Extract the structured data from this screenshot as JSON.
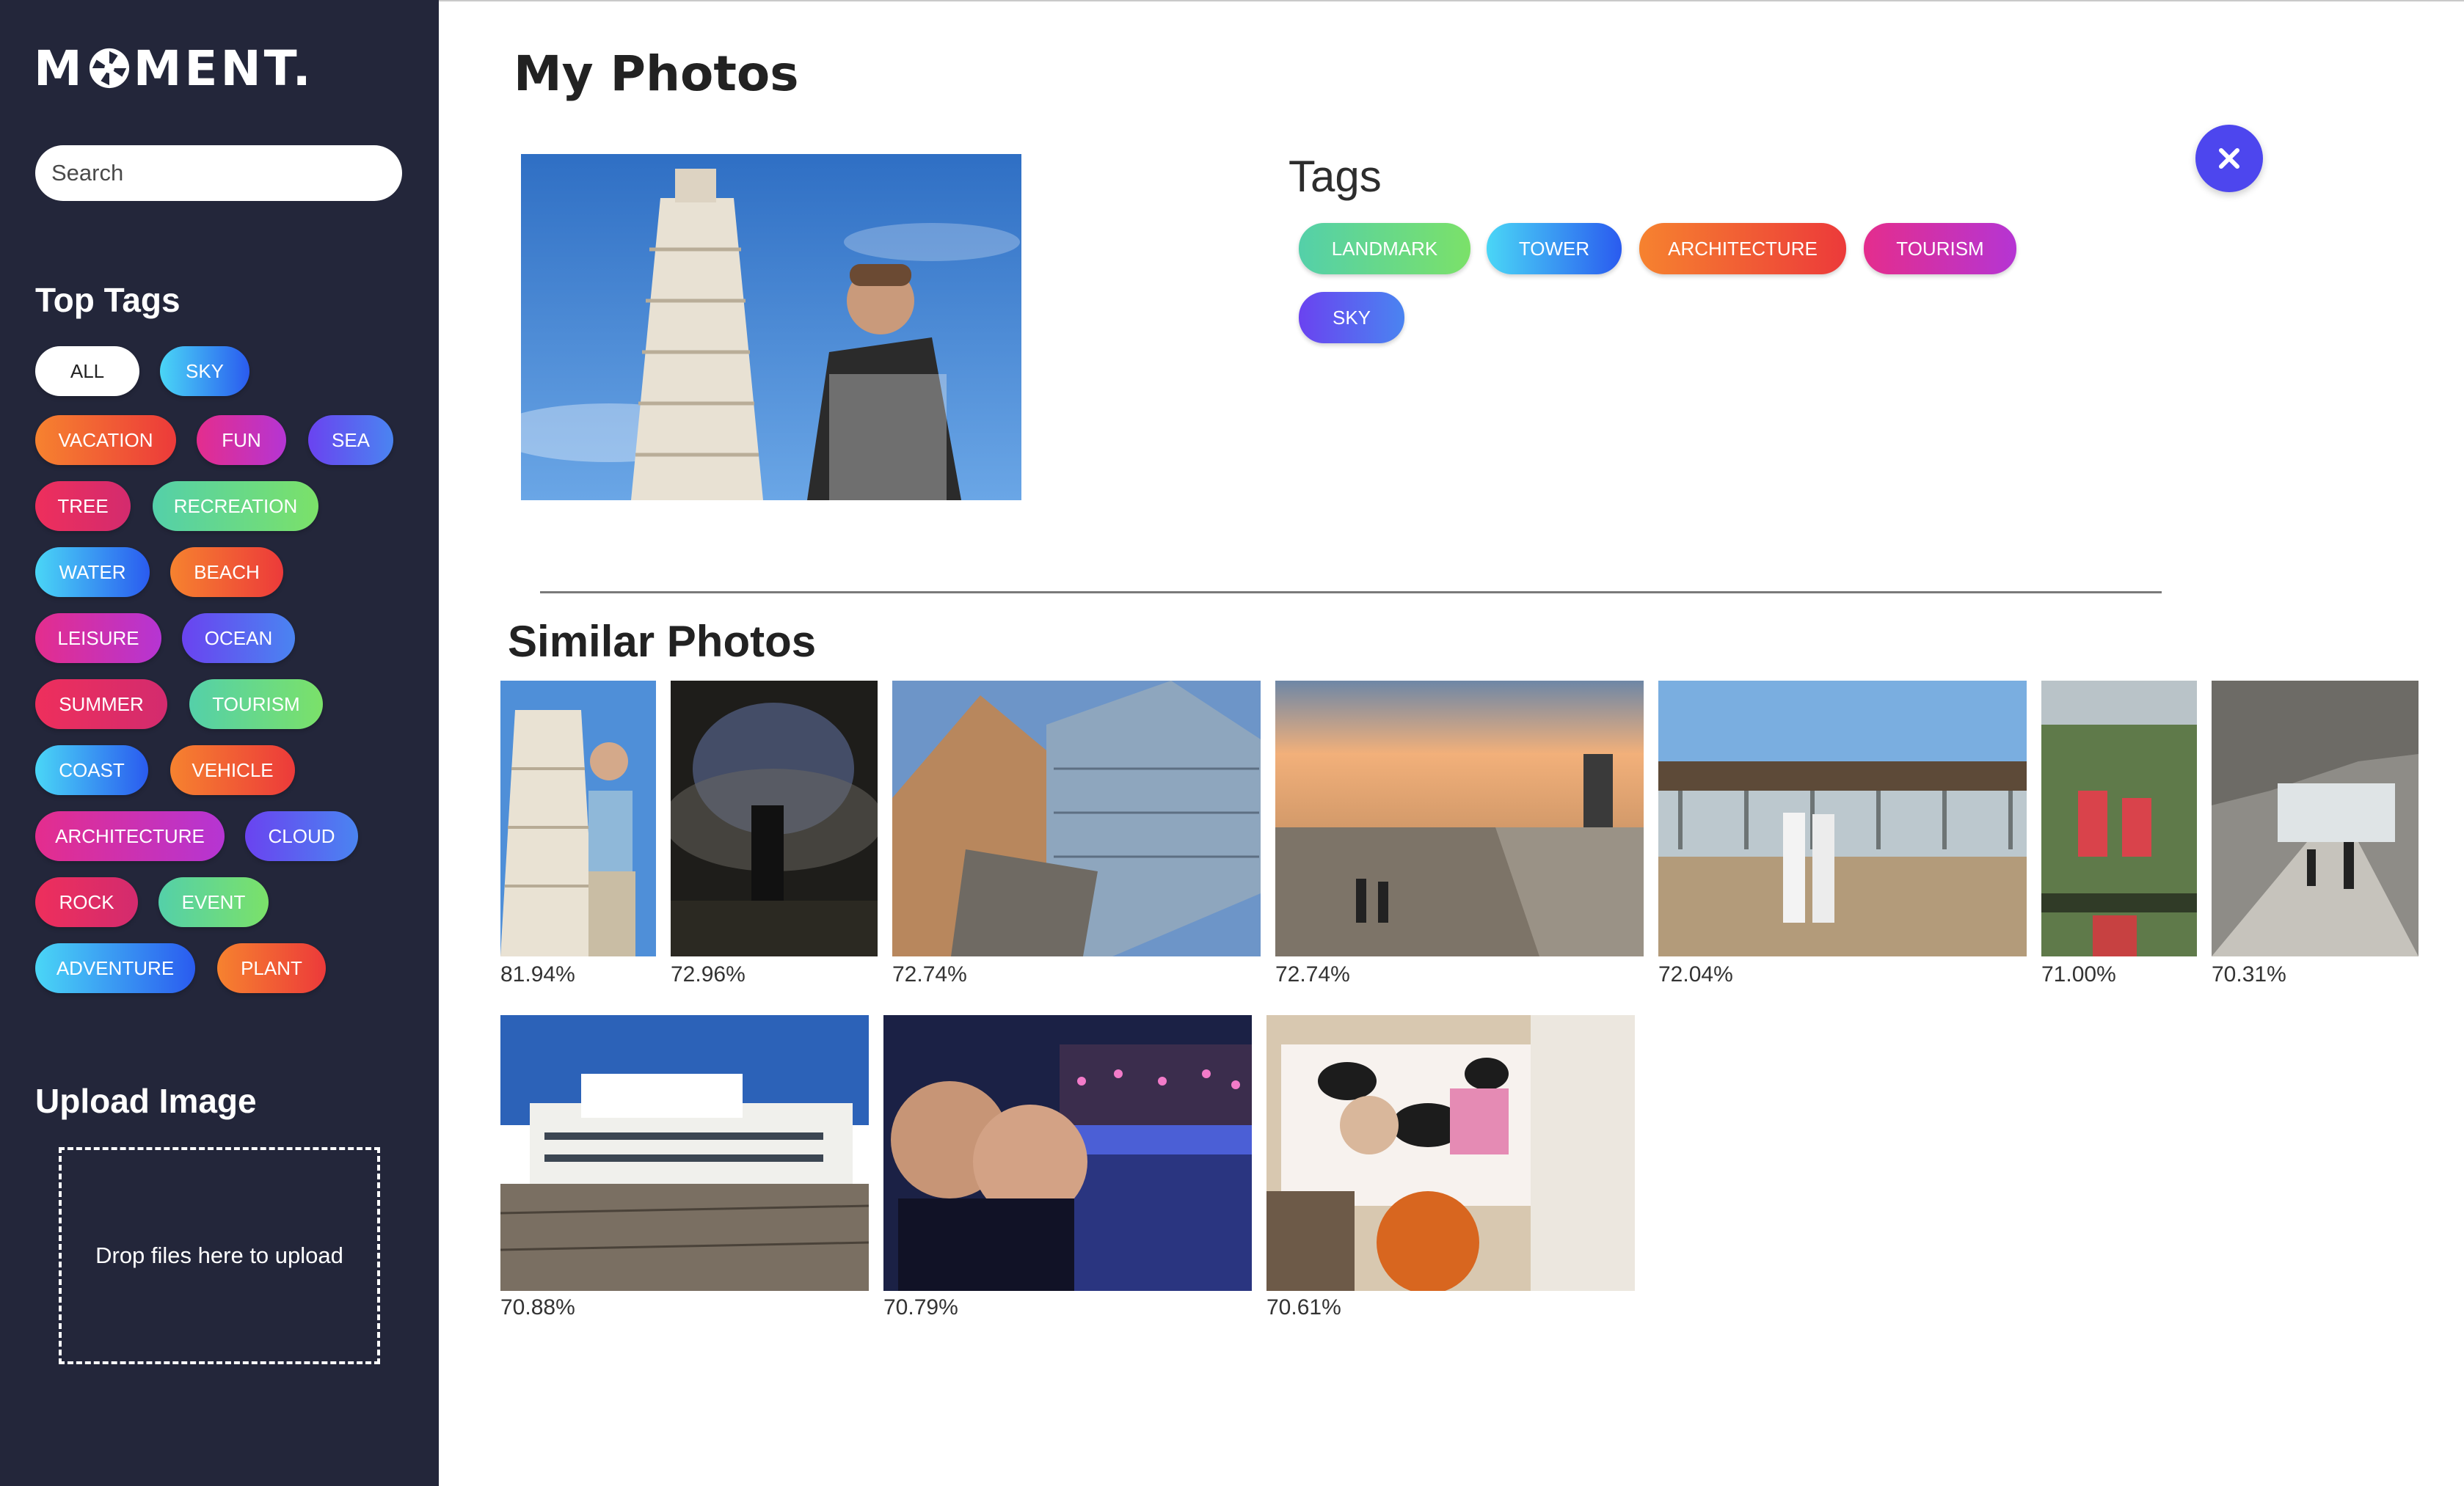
{
  "brand": {
    "left": "M",
    "right": "MENT."
  },
  "sidebar": {
    "search_placeholder": "Search",
    "top_tags_title": "Top Tags",
    "tags": [
      "ALL",
      "SKY",
      "VACATION",
      "FUN",
      "SEA",
      "TREE",
      "RECREATION",
      "WATER",
      "BEACH",
      "LEISURE",
      "OCEAN",
      "SUMMER",
      "TOURISM",
      "COAST",
      "VEHICLE",
      "ARCHITECTURE",
      "CLOUD",
      "ROCK",
      "EVENT",
      "ADVENTURE",
      "PLANT"
    ],
    "upload_title": "Upload Image",
    "dropzone_text": "Drop files here to upload"
  },
  "main": {
    "title": "My Photos",
    "tags_title": "Tags",
    "photo_tags": [
      "LANDMARK",
      "TOWER",
      "ARCHITECTURE",
      "TOURISM",
      "SKY"
    ],
    "similar_title": "Similar Photos",
    "similar_scores": [
      "81.94%",
      "72.96%",
      "72.74%",
      "72.74%",
      "72.04%",
      "71.00%",
      "70.31%",
      "70.88%",
      "70.79%",
      "70.61%"
    ]
  },
  "icons": {
    "close": "close-icon",
    "logo": "aperture-icon"
  },
  "colors": {
    "sidebar_bg": "#23263a",
    "close_button": "#4d46ee"
  }
}
